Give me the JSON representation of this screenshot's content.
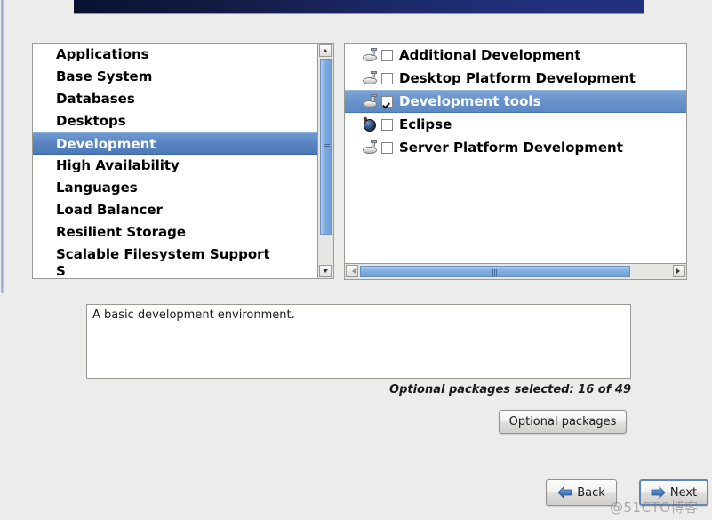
{
  "banner": {
    "accent_color": "#1c2a6b"
  },
  "group_list": {
    "items": [
      {
        "label": "Applications",
        "selected": false
      },
      {
        "label": "Base System",
        "selected": false
      },
      {
        "label": "Databases",
        "selected": false
      },
      {
        "label": "Desktops",
        "selected": false
      },
      {
        "label": "Development",
        "selected": true
      },
      {
        "label": "High Availability",
        "selected": false
      },
      {
        "label": "Languages",
        "selected": false
      },
      {
        "label": "Load Balancer",
        "selected": false
      },
      {
        "label": "Resilient Storage",
        "selected": false
      },
      {
        "label": "Scalable Filesystem Support",
        "selected": false
      },
      {
        "label": "S",
        "selected": false,
        "clipped": true
      }
    ],
    "scrollbar": {
      "up_icon": "triangle-up-icon",
      "down_icon": "triangle-down-icon",
      "thumb_position_percent": 0,
      "thumb_size_percent": 75
    }
  },
  "package_list": {
    "items": [
      {
        "label": "Additional Development",
        "checked": false,
        "selected": false,
        "icon": "package-icon"
      },
      {
        "label": "Desktop Platform Development",
        "checked": false,
        "selected": false,
        "icon": "package-icon"
      },
      {
        "label": "Development tools",
        "checked": true,
        "selected": true,
        "icon": "package-icon"
      },
      {
        "label": "Eclipse",
        "checked": false,
        "selected": false,
        "icon": "eclipse-sphere-icon"
      },
      {
        "label": "Server Platform Development",
        "checked": false,
        "selected": false,
        "icon": "package-icon"
      }
    ],
    "scrollbar": {
      "left_icon": "triangle-left-icon",
      "right_icon": "triangle-right-icon",
      "thumb_size_percent": 84
    },
    "selection_color": "#5c88c3"
  },
  "description": {
    "text": "A basic development environment."
  },
  "optional": {
    "count_text": "Optional packages selected: 16 of 49",
    "selected_count": 16,
    "total_count": 49,
    "button_label": "Optional packages"
  },
  "navigation": {
    "back_label": "Back",
    "back_icon": "arrow-left-icon",
    "next_label": "Next",
    "next_icon": "arrow-right-icon"
  },
  "watermark": {
    "text": "@51CTO博客"
  }
}
